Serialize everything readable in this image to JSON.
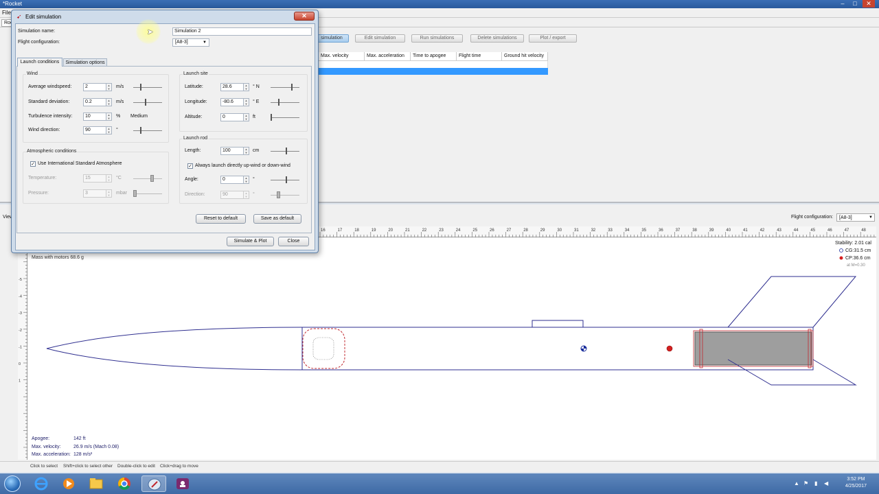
{
  "window": {
    "title": "*Rocket",
    "menu_file": "File",
    "rocket_tab": "Rocket"
  },
  "toolbar": {
    "new_simulation": "simulation",
    "edit_simulation": "Edit simulation",
    "run_simulations": "Run simulations",
    "delete_simulations": "Delete simulations",
    "plot_export": "Plot / export"
  },
  "sim_table": {
    "columns": [
      "Max. velocity",
      "Max. acceleration",
      "Time to apogee",
      "Flight time",
      "Ground hit velocity"
    ]
  },
  "dialog": {
    "title": "Edit simulation",
    "close_glyph": "✕",
    "sim_name_label": "Simulation name:",
    "sim_name_value": "Simulation 2",
    "flight_config_label": "Flight configuration:",
    "flight_config_value": "[A8-3]",
    "tabs": [
      "Launch conditions",
      "Simulation options"
    ],
    "wind": {
      "title": "Wind",
      "avg_label": "Average windspeed:",
      "avg_value": "2",
      "avg_unit": "m/s",
      "std_label": "Standard deviation:",
      "std_value": "0.2",
      "std_unit": "m/s",
      "turb_label": "Turbulence intensity:",
      "turb_value": "10",
      "turb_unit": "%",
      "turb_desc": "Medium",
      "dir_label": "Wind direction:",
      "dir_value": "90",
      "dir_unit": "°"
    },
    "atmos": {
      "title": "Atmospheric conditions",
      "isa_label": "Use International Standard Atmosphere",
      "isa_checked": true,
      "temp_label": "Temperature:",
      "temp_value": "15",
      "temp_unit": "°C",
      "press_label": "Pressure:",
      "press_value": "3",
      "press_unit": "mbar"
    },
    "site": {
      "title": "Launch site",
      "lat_label": "Latitude:",
      "lat_value": "28.6",
      "lat_unit": "° N",
      "lon_label": "Longitude:",
      "lon_value": "-80.6",
      "lon_unit": "° E",
      "alt_label": "Altitude:",
      "alt_value": "0",
      "alt_unit": "ft"
    },
    "rod": {
      "title": "Launch rod",
      "len_label": "Length:",
      "len_value": "100",
      "len_unit": "cm",
      "always_label": "Always launch directly up-wind or down-wind",
      "always_checked": true,
      "angle_label": "Angle:",
      "angle_value": "0",
      "angle_unit": "°",
      "dir_label": "Direction:",
      "dir_value": "90",
      "dir_unit": "°"
    },
    "buttons": {
      "reset": "Reset to default",
      "save_default": "Save as default",
      "simulate_plot": "Simulate & Plot",
      "close": "Close"
    }
  },
  "design": {
    "view_label": "View",
    "flight_config_label": "Flight configuration:",
    "flight_config_value": "[A8-3]",
    "mass_text": "Mass with motors 68.6 g",
    "stability": "Stability: 2.01 cal",
    "cg": "CG:31.5 cm",
    "cp": "CP:36.6 cm",
    "at_m": "at M=0.30",
    "apogee_label": "Apogee:",
    "apogee_value": "142 ft",
    "velocity_label": "Max. velocity:",
    "velocity_value": "26.9 m/s  (Mach 0.08)",
    "accel_label": "Max. acceleration:",
    "accel_value": "128 m/s²",
    "ruler_top_labels": [
      "16",
      "17",
      "18",
      "19",
      "20",
      "21",
      "22",
      "23",
      "24",
      "25",
      "26",
      "27",
      "28",
      "29",
      "30",
      "31",
      "32",
      "33",
      "34",
      "35",
      "36",
      "37",
      "38",
      "39",
      "40",
      "41",
      "42",
      "43",
      "44",
      "45",
      "46",
      "47",
      "48"
    ],
    "ruler_left_labels": [
      "-5",
      "-4",
      "-3",
      "-2",
      "-1",
      "0",
      "1"
    ],
    "colors": {
      "outline": "#2e2e8f",
      "motor": "#9e9e9e",
      "cp_red": "#d42020",
      "cg_blue": "#1a2d9c"
    }
  },
  "status": {
    "click_select": "Click to select",
    "shift_click": "Shift+click to select other",
    "double_click": "Double-click to edit",
    "click_drag": "Click+drag to move"
  },
  "taskbar": {
    "time": "3:52 PM",
    "date": "4/25/2017"
  }
}
